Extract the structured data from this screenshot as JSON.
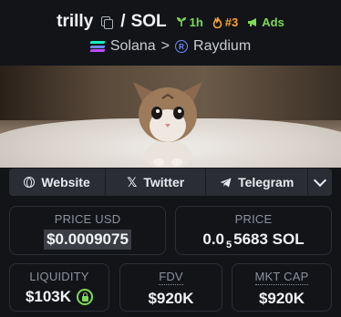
{
  "header": {
    "token_name": "trilly",
    "separator": "/",
    "quote": "SOL",
    "age_badge": "1h",
    "rank_badge": "#3",
    "ads_badge": "Ads",
    "chain": "Solana",
    "breadcrumb_sep": ">",
    "dex": "Raydium"
  },
  "socials": {
    "website": "Website",
    "twitter": "Twitter",
    "telegram": "Telegram"
  },
  "stats": {
    "price_usd_label": "PRICE USD",
    "price_usd": "$0.0009075",
    "price_native_label": "PRICE",
    "price_native_prefix": "0.0",
    "price_native_zeros": "5",
    "price_native_rest": "5683 SOL",
    "liquidity_label": "LIQUIDITY",
    "liquidity": "$103K",
    "fdv_label": "FDV",
    "fdv": "$920K",
    "mcap_label": "MKT CAP",
    "mcap": "$920K"
  },
  "colors": {
    "background": "#121418",
    "accent_green": "#7ed957",
    "accent_orange": "#f7a531",
    "dex_blue": "#6b8cff"
  },
  "icons": [
    "copy-icon",
    "seedling-icon",
    "fire-icon",
    "megaphone-icon",
    "solana-icon",
    "raydium-icon",
    "globe-icon",
    "x-icon",
    "telegram-icon",
    "chevron-down-icon",
    "lock-icon"
  ]
}
